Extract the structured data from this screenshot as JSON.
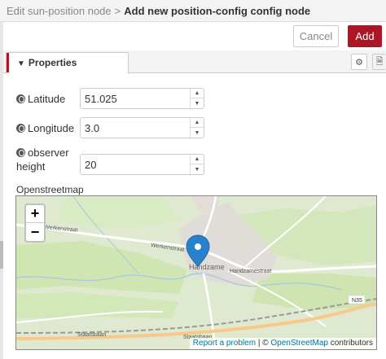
{
  "breadcrumb": {
    "parent": "Edit sun-position node",
    "separator": ">",
    "current": "Add new position-config config node"
  },
  "toolbar": {
    "cancel_label": "Cancel",
    "add_label": "Add"
  },
  "tabs": {
    "properties_label": "Properties",
    "properties_icon": "chevron-down-icon",
    "settings_icon": "gear-icon",
    "description_icon": "document-icon"
  },
  "fields": {
    "latitude": {
      "label": "Latitude",
      "value": "51.025",
      "icon": "globe-icon"
    },
    "longitude": {
      "label": "Longitude",
      "value": "3.0",
      "icon": "globe-icon"
    },
    "height": {
      "label_line1": "observer",
      "label_line2": "height",
      "value": "20",
      "icon": "globe-icon"
    }
  },
  "map": {
    "label": "Openstreetmap",
    "zoom_in": "+",
    "zoom_out": "−",
    "place_labels": {
      "werkenstraat_1": "Werkenstraat",
      "werkenstraat_2": "Werkenstraat",
      "handzame": "Handzame",
      "handzamestraat": "Handzamestraat",
      "staatsbaan_1": "Staatsbaan",
      "staatsbaan_2": "Staatsbaan",
      "n35": "N35"
    },
    "attribution": {
      "report": "Report a problem",
      "sep": " | © ",
      "osm": "OpenStreetMap",
      "contributors": " contributors"
    },
    "colors": {
      "land": "#dfe9cf",
      "field": "#cde6b0",
      "urban": "#e0dcd8",
      "road": "#ffffff",
      "highway": "#f7c98a",
      "rail": "#999999",
      "water": "#a8c8e0",
      "marker": "#2a81cb"
    }
  }
}
